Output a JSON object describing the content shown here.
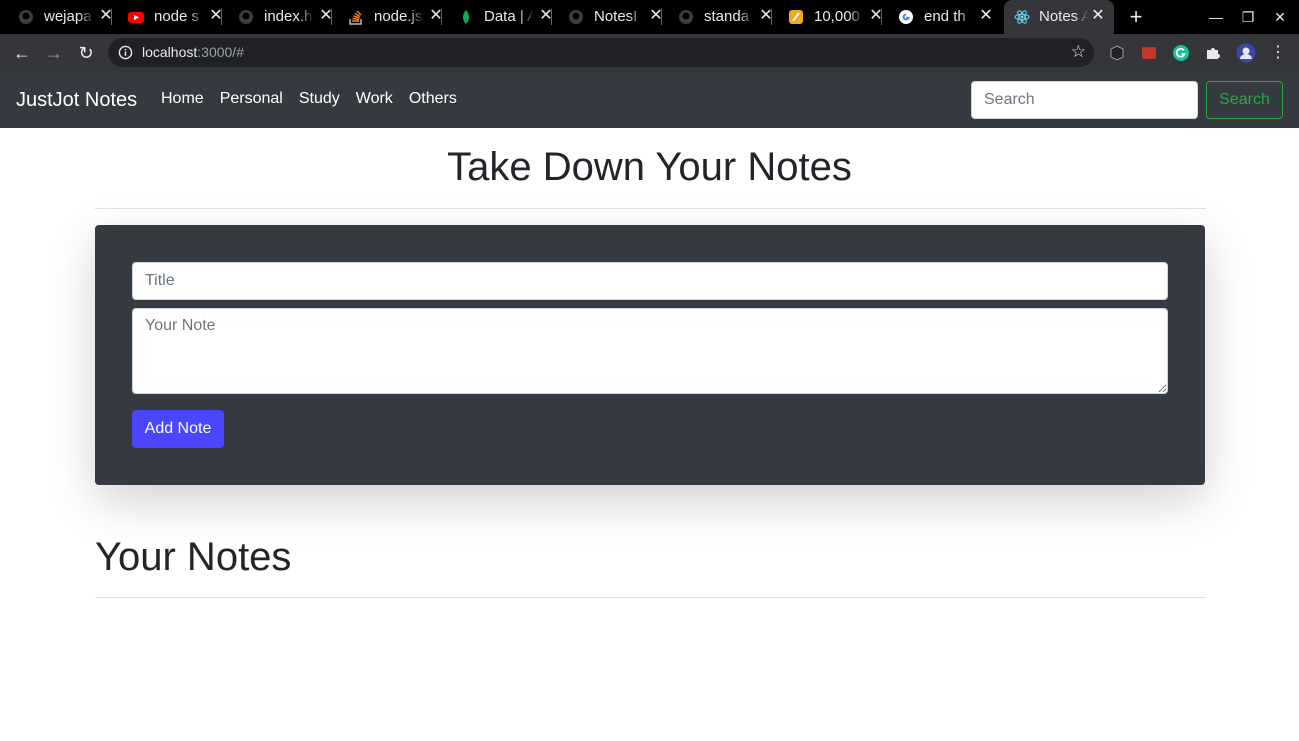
{
  "browser": {
    "tabs": [
      {
        "title": "wejapa",
        "icon": "github-icon"
      },
      {
        "title": "node s",
        "icon": "youtube-icon"
      },
      {
        "title": "index.h",
        "icon": "github-icon"
      },
      {
        "title": "node.js",
        "icon": "stackoverflow-icon"
      },
      {
        "title": "Data | A",
        "icon": "mongodb-leaf-icon"
      },
      {
        "title": "NotesI",
        "icon": "github-icon"
      },
      {
        "title": "standa",
        "icon": "github-icon"
      },
      {
        "title": "10,000",
        "icon": "orange-app-icon"
      },
      {
        "title": "end th",
        "icon": "google-icon"
      },
      {
        "title": "Notes A",
        "icon": "react-icon",
        "active": true
      }
    ],
    "url_host": "localhost",
    "url_rest": ":3000/#"
  },
  "app": {
    "brand": "JustJot Notes",
    "nav": [
      "Home",
      "Personal",
      "Study",
      "Work",
      "Others"
    ],
    "search_placeholder": "Search",
    "search_button": "Search"
  },
  "main": {
    "heading": "Take Down Your Notes",
    "title_placeholder": "Title",
    "note_placeholder": "Your Note",
    "add_button": "Add Note",
    "notes_heading": "Your Notes"
  },
  "colors": {
    "navbar": "#343a40",
    "accent_button": "#4a46ff",
    "search_outline": "#28a745"
  }
}
